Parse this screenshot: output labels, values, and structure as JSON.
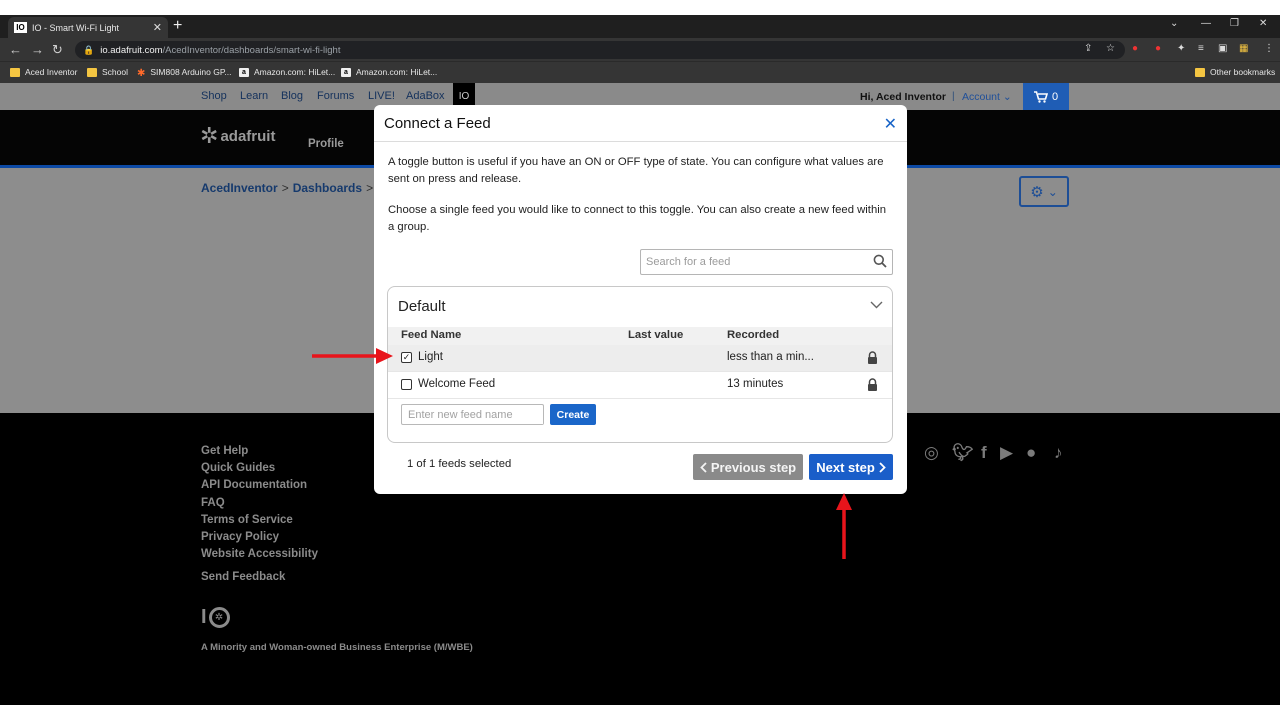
{
  "browser": {
    "tab_title": "IO - Smart Wi-Fi Light",
    "tab_favicon": "IO",
    "url_host": "io.adafruit.com",
    "url_path": "/AcedInventor/dashboards/smart-wi-fi-light",
    "bookmarks": [
      "Aced Inventor",
      "School",
      "SIM808 Arduino GP...",
      "Amazon.com: HiLet...",
      "Amazon.com: HiLet..."
    ],
    "other_bookmarks": "Other bookmarks"
  },
  "topnav": {
    "links": [
      "Shop",
      "Learn",
      "Blog",
      "Forums",
      "LIVE!",
      "AdaBox"
    ],
    "io": "IO",
    "greeting": "Hi, Aced Inventor",
    "separator": "|",
    "account": "Account",
    "cart_count": "0"
  },
  "header": {
    "logo_text": "adafruit",
    "profile": "Profile"
  },
  "breadcrumb": {
    "items": [
      "AcedInventor",
      "Dashboards"
    ]
  },
  "footer": {
    "links": [
      "Get Help",
      "Quick Guides",
      "API Documentation",
      "FAQ",
      "Terms of Service",
      "Privacy Policy",
      "Website Accessibility",
      "Send Feedback"
    ],
    "tagline": "A Minority and Woman-owned Business Enterprise (M/WBE)"
  },
  "modal": {
    "title": "Connect a Feed",
    "description1": "A toggle button is useful if you have an ON or OFF type of state. You can configure what values are sent on press and release.",
    "description2": "Choose a single feed you would like to connect to this toggle. You can also create a new feed within a group.",
    "search_placeholder": "Search for a feed",
    "group": {
      "name": "Default",
      "columns": [
        "Feed Name",
        "Last value",
        "Recorded"
      ],
      "rows": [
        {
          "name": "Light",
          "last_value": "",
          "recorded": "less than a min...",
          "checked": true
        },
        {
          "name": "Welcome Feed",
          "last_value": "",
          "recorded": "13 minutes",
          "checked": false
        }
      ],
      "new_feed_placeholder": "Enter new feed name",
      "create_label": "Create"
    },
    "selected_count": "1 of 1 feeds selected",
    "prev_label": "Previous step",
    "next_label": "Next step"
  },
  "colors": {
    "accent": "#1a5ec9",
    "annotation_arrow": "#e8141b",
    "overlay_content": "#8d8d8d"
  }
}
